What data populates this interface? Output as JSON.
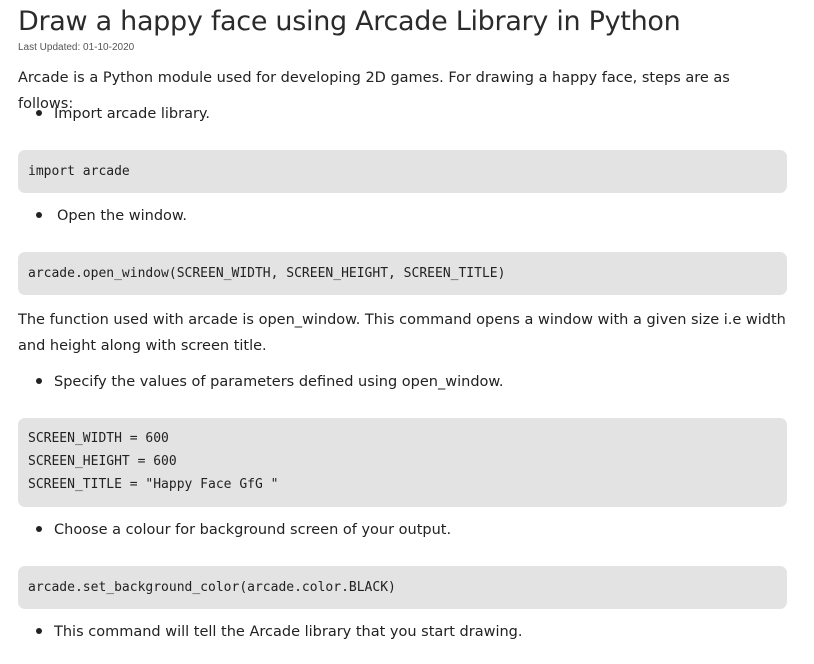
{
  "article": {
    "title": "Draw a happy face using Arcade Library in Python",
    "last_updated": "Last Updated: 01-10-2020",
    "intro": "Arcade is a Python module used for developing 2D games. For drawing a happy face, steps are as follows:",
    "bullets": [
      "Import arcade library.",
      "Open the window.",
      "Specify the values of parameters defined using open_window.",
      "Choose a colour for background screen of your output.",
      "This command will tell the Arcade library that you start drawing."
    ],
    "code_blocks": [
      [
        "import arcade"
      ],
      [
        "arcade.open_window(SCREEN_WIDTH, SCREEN_HEIGHT, SCREEN_TITLE)"
      ],
      [
        "SCREEN_WIDTH = 600",
        "SCREEN_HEIGHT = 600",
        "SCREEN_TITLE = \"Happy Face GfG \""
      ],
      [
        "arcade.set_background_color(arcade.color.BLACK)"
      ]
    ],
    "explanation": "The function used with arcade is open_window. This command opens a window with a given size i.e width and height along with screen title."
  }
}
